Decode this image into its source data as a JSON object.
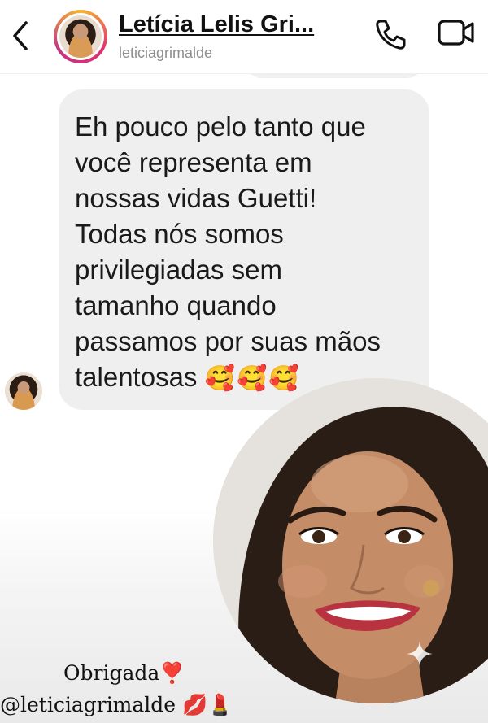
{
  "header": {
    "name": "Letícia Lelis Gri...",
    "handle": "leticiagrimalde",
    "back_icon": "chevron-left-icon",
    "call_icon": "phone-icon",
    "video_icon": "video-camera-icon"
  },
  "message": {
    "text": "Eh pouco pelo tanto que\nvocê representa em\nnossas vidas Guetti!\nTodas nós somos\nprivilegiadas sem\ntamanho quando\npassamos por suas mãos\ntalentosas ",
    "emoji": "🥰🥰🥰"
  },
  "caption": {
    "line1": "Obrigada",
    "line1_emoji": "❣️",
    "line2": "@leticiagrimalde",
    "line2_emoji": "💋💄"
  },
  "colors": {
    "bubble": "#efefef",
    "handle": "#8e8e8e",
    "story_ring": "#e1306c"
  }
}
